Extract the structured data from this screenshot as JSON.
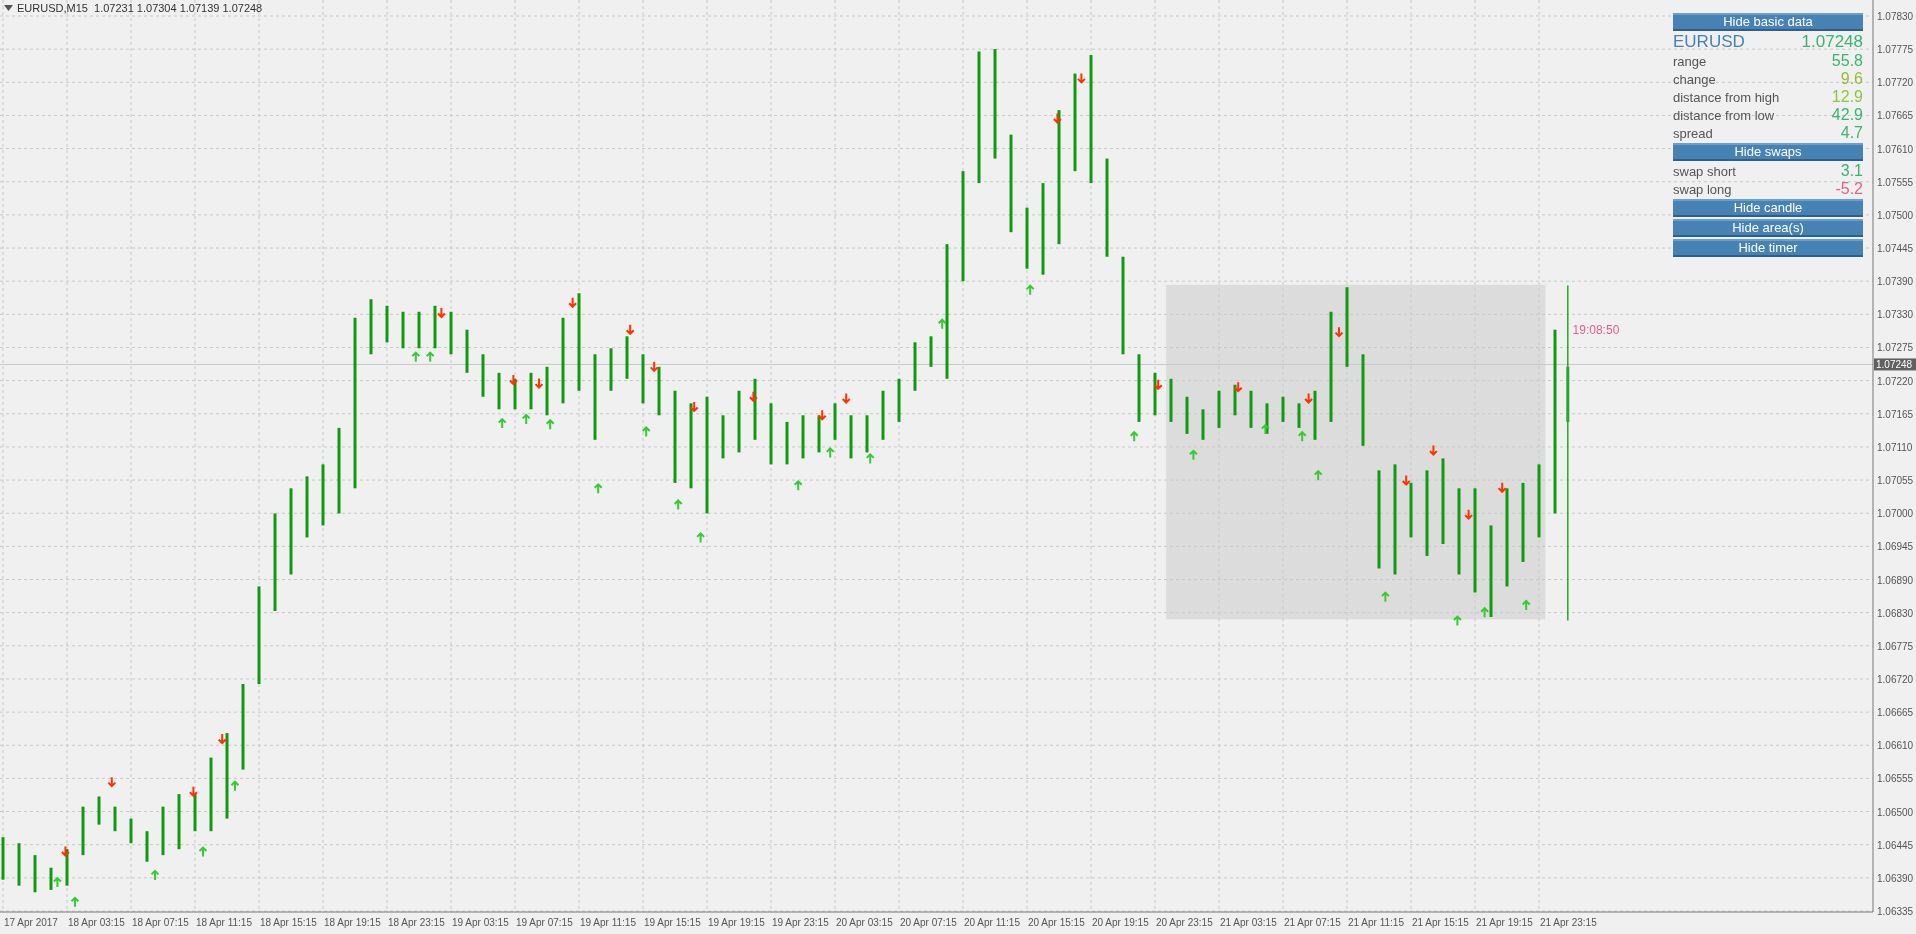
{
  "header": {
    "text": "EURUSD,M15  1.07231 1.07304 1.07139 1.07248"
  },
  "chart": {
    "price_labels": [
      "1.07830",
      "1.07775",
      "1.07720",
      "1.07665",
      "1.07610",
      "1.07555",
      "1.07500",
      "1.07445",
      "1.07390",
      "1.07330",
      "1.07275",
      "1.07220",
      "1.07165",
      "1.07110",
      "1.07055",
      "1.07000",
      "1.06945",
      "1.06890",
      "1.06830",
      "1.06775",
      "1.06720",
      "1.06665",
      "1.06610",
      "1.06555",
      "1.06500",
      "1.06445",
      "1.06390",
      "1.06335"
    ],
    "time_labels": [
      "17 Apr 2017",
      "18 Apr 03:15",
      "18 Apr 07:15",
      "18 Apr 11:15",
      "18 Apr 15:15",
      "18 Apr 19:15",
      "18 Apr 23:15",
      "19 Apr 03:15",
      "19 Apr 07:15",
      "19 Apr 11:15",
      "19 Apr 15:15",
      "19 Apr 19:15",
      "19 Apr 23:15",
      "20 Apr 03:15",
      "20 Apr 07:15",
      "20 Apr 11:15",
      "20 Apr 15:15",
      "20 Apr 19:15",
      "20 Apr 23:15",
      "21 Apr 03:15",
      "21 Apr 07:15",
      "21 Apr 11:15",
      "21 Apr 15:15",
      "21 Apr 19:15",
      "21 Apr 23:15"
    ],
    "current_price": "1.07248",
    "timer": "19:08:50"
  },
  "panel": {
    "items": [
      {
        "kind": "button",
        "label": "Hide basic data"
      },
      {
        "kind": "symbol",
        "label": "EURUSD",
        "value": "1.07248",
        "color": "#3cb371"
      },
      {
        "kind": "row",
        "label": "range",
        "value": "55.8",
        "color": "#3cb371"
      },
      {
        "kind": "row",
        "label": "change",
        "value": "9.6",
        "color": "#9ab83a"
      },
      {
        "kind": "row",
        "label": "distance from high",
        "value": "12.9",
        "color": "#8cc63f"
      },
      {
        "kind": "row",
        "label": "distance from low",
        "value": "42.9",
        "color": "#3cb371"
      },
      {
        "kind": "row",
        "label": "spread",
        "value": "4.7",
        "color": "#3cb371"
      },
      {
        "kind": "button",
        "label": "Hide swaps"
      },
      {
        "kind": "row",
        "label": "swap short",
        "value": "3.1",
        "color": "#3cb371"
      },
      {
        "kind": "row",
        "label": "swap long",
        "value": "-5.2",
        "color": "#e0608a"
      },
      {
        "kind": "button",
        "label": "Hide candle"
      },
      {
        "kind": "button",
        "label": "Hide area(s)"
      },
      {
        "kind": "button",
        "label": "Hide timer"
      }
    ]
  }
}
